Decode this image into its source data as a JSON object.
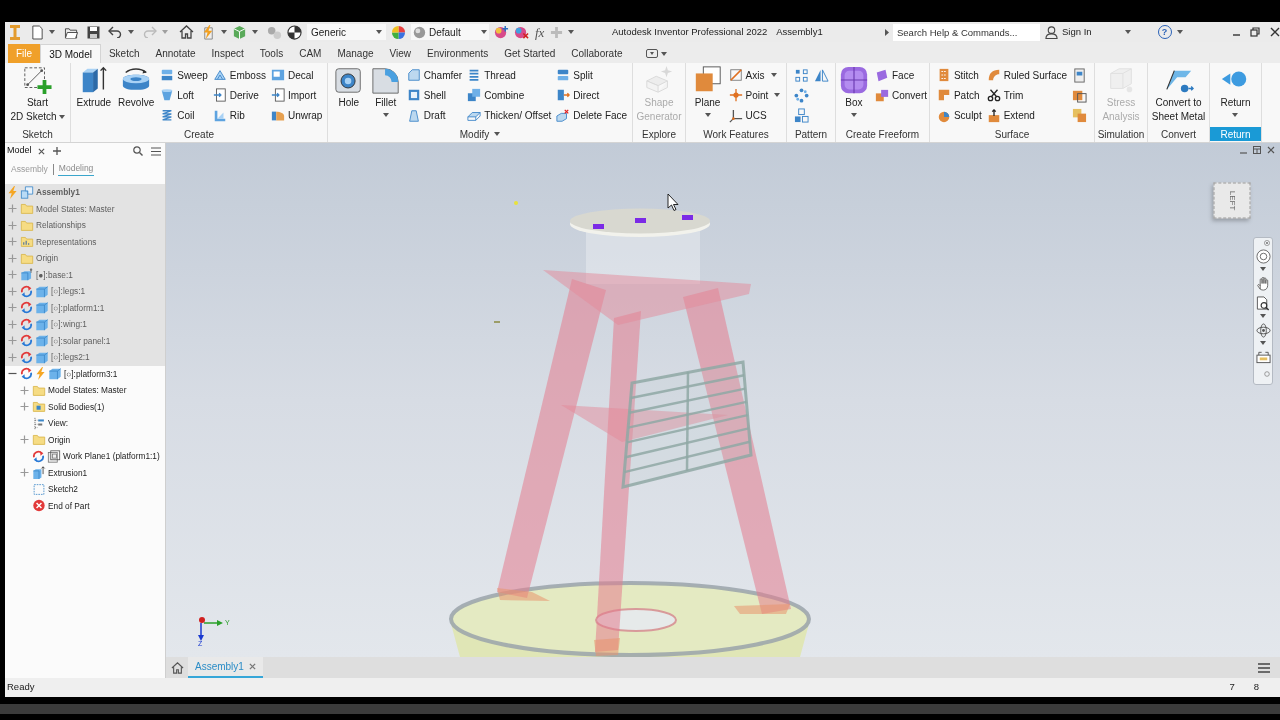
{
  "title_bar": {
    "quick_access": {
      "material": "Generic",
      "appearance": "Default",
      "parameters": "fx"
    },
    "app_title": "Autodesk Inventor Professional 2022",
    "document": "Assembly1",
    "search": {
      "placeholder": "Search Help & Commands..."
    },
    "account": "Sign In",
    "help": "?"
  },
  "ribbon_tabs": [
    {
      "label": "File",
      "kind": "file",
      "selected": false
    },
    {
      "label": "3D Model",
      "kind": "tab",
      "selected": true
    },
    {
      "label": "Sketch",
      "kind": "tab",
      "selected": false
    },
    {
      "label": "Annotate",
      "kind": "tab",
      "selected": false
    },
    {
      "label": "Inspect",
      "kind": "tab",
      "selected": false
    },
    {
      "label": "Tools",
      "kind": "tab",
      "selected": false
    },
    {
      "label": "CAM",
      "kind": "tab",
      "selected": false
    },
    {
      "label": "Manage",
      "kind": "tab",
      "selected": false
    },
    {
      "label": "View",
      "kind": "tab",
      "selected": false
    },
    {
      "label": "Environments",
      "kind": "tab",
      "selected": false
    },
    {
      "label": "Get Started",
      "kind": "tab",
      "selected": false
    },
    {
      "label": "Collaborate",
      "kind": "tab",
      "selected": false
    }
  ],
  "ribbon_groups": [
    {
      "label": "Sketch",
      "menu": false,
      "highlighted": false,
      "columns": [
        [
          {
            "kind": "large",
            "label": "Start\n2D Sketch",
            "disabled": false,
            "dropdown": true
          }
        ]
      ]
    },
    {
      "label": "Create",
      "menu": false,
      "highlighted": false,
      "columns": [
        [
          {
            "kind": "large",
            "label": "Extrude",
            "disabled": false,
            "dropdown": false
          }
        ],
        [
          {
            "kind": "large",
            "label": "Revolve",
            "disabled": false,
            "dropdown": false
          }
        ],
        [
          {
            "kind": "small",
            "label": "Sweep",
            "disabled": false,
            "dropdown": false
          },
          {
            "kind": "small",
            "label": "Loft",
            "disabled": false,
            "dropdown": false
          },
          {
            "kind": "small",
            "label": "Coil",
            "disabled": false,
            "dropdown": false
          }
        ],
        [
          {
            "kind": "small",
            "label": "Emboss",
            "disabled": false,
            "dropdown": false
          },
          {
            "kind": "small",
            "label": "Derive",
            "disabled": false,
            "dropdown": false
          },
          {
            "kind": "small",
            "label": "Rib",
            "disabled": false,
            "dropdown": false
          }
        ],
        [
          {
            "kind": "small",
            "label": "Decal",
            "disabled": false,
            "dropdown": false
          },
          {
            "kind": "small",
            "label": "Import",
            "disabled": false,
            "dropdown": false
          },
          {
            "kind": "small",
            "label": "Unwrap",
            "disabled": false,
            "dropdown": false
          }
        ]
      ]
    },
    {
      "label": "Modify",
      "menu": true,
      "highlighted": false,
      "columns": [
        [
          {
            "kind": "large",
            "label": "Hole",
            "disabled": false,
            "dropdown": false
          }
        ],
        [
          {
            "kind": "large",
            "label": "Fillet",
            "disabled": false,
            "dropdown": true
          }
        ],
        [
          {
            "kind": "small",
            "label": "Chamfer",
            "disabled": false,
            "dropdown": false
          },
          {
            "kind": "small",
            "label": "Shell",
            "disabled": false,
            "dropdown": false
          },
          {
            "kind": "small",
            "label": "Draft",
            "disabled": false,
            "dropdown": false
          }
        ],
        [
          {
            "kind": "small",
            "label": "Thread",
            "disabled": false,
            "dropdown": false
          },
          {
            "kind": "small",
            "label": "Combine",
            "disabled": false,
            "dropdown": false
          },
          {
            "kind": "small",
            "label": "Thicken/ Offset",
            "disabled": false,
            "dropdown": false
          }
        ],
        [
          {
            "kind": "small",
            "label": "Split",
            "disabled": false,
            "dropdown": false
          },
          {
            "kind": "small",
            "label": "Direct",
            "disabled": false,
            "dropdown": false
          },
          {
            "kind": "small",
            "label": "Delete Face",
            "disabled": false,
            "dropdown": false
          }
        ]
      ]
    },
    {
      "label": "Explore",
      "menu": false,
      "highlighted": false,
      "columns": [
        [
          {
            "kind": "large",
            "label": "Shape\nGenerator",
            "disabled": true,
            "dropdown": false
          }
        ]
      ]
    },
    {
      "label": "Work Features",
      "menu": false,
      "highlighted": false,
      "columns": [
        [
          {
            "kind": "large",
            "label": "Plane",
            "disabled": false,
            "dropdown": true
          }
        ],
        [
          {
            "kind": "small",
            "label": "Axis",
            "disabled": false,
            "dropdown": true
          },
          {
            "kind": "small",
            "label": "Point",
            "disabled": false,
            "dropdown": true
          },
          {
            "kind": "small",
            "label": "UCS",
            "disabled": false,
            "dropdown": false
          }
        ]
      ]
    },
    {
      "label": "Pattern",
      "menu": false,
      "highlighted": false,
      "columns": [
        [
          {
            "kind": "icon",
            "disabled": false,
            "dropdown": false
          },
          {
            "kind": "icon",
            "disabled": false,
            "dropdown": false
          },
          {
            "kind": "icon",
            "disabled": false,
            "dropdown": false
          }
        ],
        [
          {
            "kind": "icon",
            "disabled": false,
            "dropdown": false
          }
        ]
      ]
    },
    {
      "label": "Create Freeform",
      "menu": false,
      "highlighted": false,
      "columns": [
        [
          {
            "kind": "large",
            "label": "Box",
            "disabled": false,
            "dropdown": true
          }
        ],
        [
          {
            "kind": "small",
            "label": "Face",
            "disabled": false,
            "dropdown": false
          },
          {
            "kind": "small",
            "label": "Convert",
            "disabled": false,
            "dropdown": false
          }
        ]
      ]
    },
    {
      "label": "Surface",
      "menu": false,
      "highlighted": false,
      "columns": [
        [
          {
            "kind": "small",
            "label": "Stitch",
            "disabled": false,
            "dropdown": false
          },
          {
            "kind": "small",
            "label": "Patch",
            "disabled": false,
            "dropdown": false
          },
          {
            "kind": "small",
            "label": "Sculpt",
            "disabled": false,
            "dropdown": false
          }
        ],
        [
          {
            "kind": "small",
            "label": "Ruled Surface",
            "disabled": false,
            "dropdown": false
          },
          {
            "kind": "small",
            "label": "Trim",
            "disabled": false,
            "dropdown": false
          },
          {
            "kind": "small",
            "label": "Extend",
            "disabled": false,
            "dropdown": false
          }
        ],
        [
          {
            "kind": "icon",
            "disabled": false,
            "dropdown": false
          },
          {
            "kind": "icon",
            "disabled": false,
            "dropdown": false
          },
          {
            "kind": "icon",
            "disabled": false,
            "dropdown": false
          }
        ]
      ]
    },
    {
      "label": "Simulation",
      "menu": false,
      "highlighted": false,
      "columns": [
        [
          {
            "kind": "large",
            "label": "Stress\nAnalysis",
            "disabled": true,
            "dropdown": false
          }
        ]
      ]
    },
    {
      "label": "Convert",
      "menu": false,
      "highlighted": false,
      "columns": [
        [
          {
            "kind": "large",
            "label": "Convert to\nSheet Metal",
            "disabled": false,
            "dropdown": false
          }
        ]
      ]
    },
    {
      "label": "Return",
      "menu": false,
      "highlighted": true,
      "columns": [
        [
          {
            "kind": "large",
            "label": "Return",
            "disabled": false,
            "dropdown": true
          }
        ]
      ]
    }
  ],
  "browser": {
    "tabs": [
      {
        "label": "Model",
        "selected": true
      }
    ],
    "modes": [
      {
        "label": "Assembly",
        "selected": false
      },
      {
        "label": "Modeling",
        "selected": true
      }
    ],
    "tree": [
      {
        "label": "Assembly1",
        "kind": "assembly",
        "adaptive": false,
        "needs_update": true,
        "inactive": true,
        "children": [
          {
            "label": "Model States: Master",
            "kind": "folder",
            "expanded": false,
            "adaptive": false,
            "needs_update": false,
            "inactive": true
          },
          {
            "label": "Relationships",
            "kind": "folder",
            "expanded": false,
            "adaptive": false,
            "needs_update": false,
            "inactive": true
          },
          {
            "label": "Representations",
            "kind": "representations",
            "expanded": false,
            "adaptive": false,
            "needs_update": false,
            "inactive": true
          },
          {
            "label": "Origin",
            "kind": "folder",
            "expanded": false,
            "adaptive": false,
            "needs_update": false,
            "inactive": true
          },
          {
            "label": "[●]:base:1",
            "kind": "grounded_part",
            "expanded": false,
            "adaptive": false,
            "needs_update": false,
            "inactive": true
          },
          {
            "label": "[○]:legs:1",
            "kind": "part",
            "expanded": false,
            "adaptive": true,
            "needs_update": false,
            "inactive": true
          },
          {
            "label": "[○]:platform1:1",
            "kind": "part",
            "expanded": false,
            "adaptive": true,
            "needs_update": false,
            "inactive": true
          },
          {
            "label": "[○]:wing:1",
            "kind": "part",
            "expanded": false,
            "adaptive": true,
            "needs_update": false,
            "inactive": true
          },
          {
            "label": "[○]:solar panel:1",
            "kind": "part",
            "expanded": false,
            "adaptive": true,
            "needs_update": false,
            "inactive": true
          },
          {
            "label": "[○]:legs2:1",
            "kind": "part",
            "expanded": false,
            "adaptive": true,
            "needs_update": false,
            "inactive": true
          },
          {
            "label": "[○]:platform3:1",
            "kind": "part",
            "expanded": true,
            "adaptive": true,
            "needs_update": true,
            "inactive": false,
            "children": [
              {
                "label": "Model States: Master",
                "kind": "folder",
                "expanded": false,
                "adaptive": false,
                "needs_update": false,
                "inactive": false
              },
              {
                "label": "Solid Bodies(1)",
                "kind": "bodies",
                "expanded": false,
                "adaptive": false,
                "needs_update": false,
                "inactive": false
              },
              {
                "label": "View:",
                "kind": "view",
                "adaptive": false,
                "needs_update": false,
                "inactive": false
              },
              {
                "label": "Origin",
                "kind": "folder",
                "expanded": false,
                "adaptive": false,
                "needs_update": false,
                "inactive": false
              },
              {
                "label": "Work Plane1 (platform1:1)",
                "kind": "work_plane",
                "adaptive": true,
                "needs_update": false,
                "inactive": false
              },
              {
                "label": "Extrusion1",
                "kind": "extrusion",
                "expanded": false,
                "adaptive": false,
                "needs_update": false,
                "inactive": false
              },
              {
                "label": "Sketch2",
                "kind": "sketch",
                "adaptive": false,
                "needs_update": false,
                "inactive": false
              },
              {
                "label": "End of Part",
                "kind": "end",
                "adaptive": false,
                "needs_update": false,
                "inactive": false
              }
            ]
          }
        ]
      }
    ]
  },
  "viewport": {
    "view_cube": {
      "face": "LEFT"
    },
    "triad": {
      "labels": [
        "Y",
        "Z"
      ]
    }
  },
  "document_tabs": [
    {
      "label": "Assembly1",
      "selected": true
    }
  ],
  "status_bar": {
    "message": "Ready",
    "indicators": [
      "7",
      "8"
    ]
  }
}
